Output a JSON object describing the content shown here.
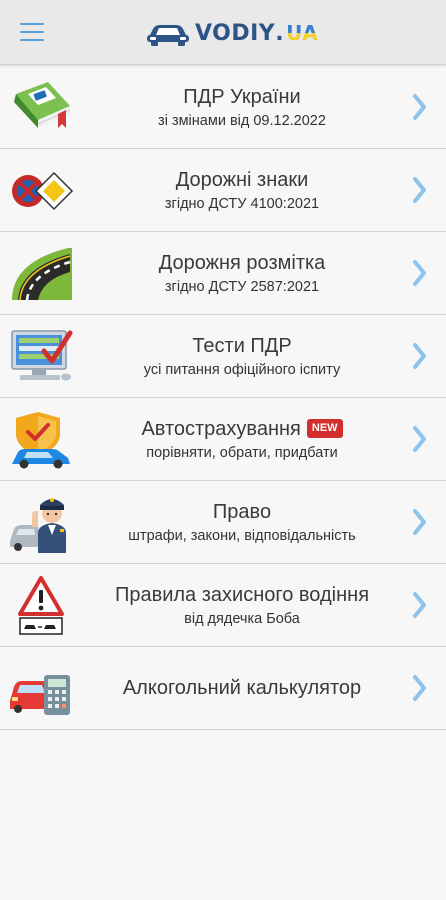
{
  "header": {
    "menu_icon": "hamburger-menu-icon",
    "logo": {
      "name": "VODIY",
      "dot": ".",
      "tld": "UA",
      "icon": "car-logo-icon"
    }
  },
  "items": [
    {
      "title": "ПДР України",
      "subtitle": "зі змінами від 09.12.2022",
      "icon": "rulebook-icon"
    },
    {
      "title": "Дорожні знаки",
      "subtitle": "згідно ДСТУ 4100:2021",
      "icon": "road-signs-icon"
    },
    {
      "title": "Дорожня розмітка",
      "subtitle": "згідно ДСТУ 2587:2021",
      "icon": "road-marking-icon"
    },
    {
      "title": "Тести ПДР",
      "subtitle": "усі питання офіційного іспиту",
      "icon": "computer-test-icon"
    },
    {
      "title": "Автострахування",
      "badge": "NEW",
      "subtitle": "порівняти, обрати, придбати",
      "icon": "car-insurance-icon"
    },
    {
      "title": "Право",
      "subtitle": "штрафи, закони, відповідальність",
      "icon": "police-officer-icon"
    },
    {
      "title": "Правила захисного водіння",
      "subtitle": "від дядечка Боба",
      "icon": "warning-sign-icon"
    },
    {
      "title": "Алкогольний калькулятор",
      "icon": "car-calculator-icon"
    }
  ],
  "colors": {
    "accent": "#5aa0d8",
    "badge": "#d32f2f",
    "logo": "#2d5486"
  }
}
